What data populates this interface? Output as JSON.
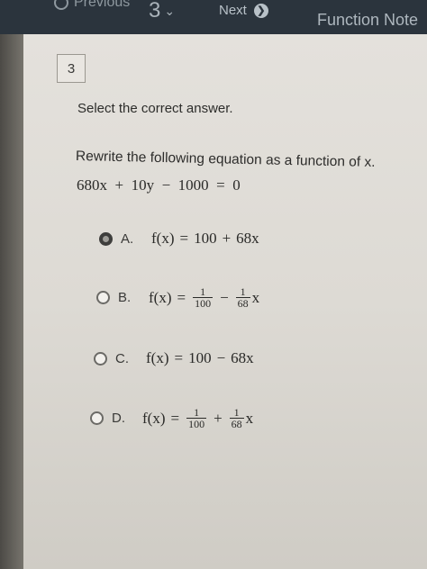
{
  "nav": {
    "previous_label": "Previous",
    "question_number": "3",
    "next_label": "Next",
    "notes_label": "Function Note"
  },
  "question": {
    "number": "3",
    "instruction": "Select the correct answer.",
    "prompt": "Rewrite the following equation as a function of x.",
    "equation": "680x  +  10y  −  1000  =  0"
  },
  "options": [
    {
      "letter": "A.",
      "selected": true,
      "lhs": "f(x)",
      "eq": "=",
      "t1": "100",
      "op": "+",
      "t2": "68x"
    },
    {
      "letter": "B.",
      "selected": false,
      "lhs": "f(x)",
      "eq": "=",
      "f1_num": "1",
      "f1_den": "100",
      "op": "−",
      "f2_num": "1",
      "f2_den": "68",
      "f2_var": "x"
    },
    {
      "letter": "C.",
      "selected": false,
      "lhs": "f(x)",
      "eq": "=",
      "t1": "100",
      "op": "−",
      "t2": "68x"
    },
    {
      "letter": "D.",
      "selected": false,
      "lhs": "f(x)",
      "eq": "=",
      "f1_num": "1",
      "f1_den": "100",
      "op": "+",
      "f2_num": "1",
      "f2_den": "68",
      "f2_var": "x"
    }
  ]
}
